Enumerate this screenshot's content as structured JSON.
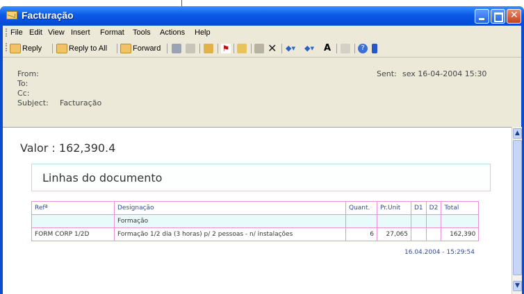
{
  "window": {
    "title": "Facturação"
  },
  "menu": [
    "File",
    "Edit",
    "View",
    "Insert",
    "Format",
    "Tools",
    "Actions",
    "Help"
  ],
  "toolbar": {
    "reply": "Reply",
    "reply_all": "Reply to All",
    "forward": "Forward"
  },
  "header": {
    "from_label": "From:",
    "to_label": "To:",
    "cc_label": "Cc:",
    "subject_label": "Subject:",
    "subject_value": "Facturação",
    "sent_label": "Sent:",
    "sent_value": "sex 16-04-2004 15:30"
  },
  "body": {
    "valor": "Valor : 162,390.4",
    "section_title": "Linhas do documento",
    "columns": [
      "Refª",
      "Designação",
      "Quant.",
      "Pr.Unit",
      "D1",
      "D2",
      "Total"
    ],
    "group_row": "Formação",
    "rows": [
      {
        "ref": "FORM CORP 1/2D",
        "designacao": "Formação 1/2 dia (3 horas) p/ 2 pessoas - n/ instalações",
        "quant": "6",
        "prunit": "27,065",
        "d1": "",
        "d2": "",
        "total": "162,390"
      }
    ],
    "timestamp": "16.04.2004 - 15:29:54"
  }
}
